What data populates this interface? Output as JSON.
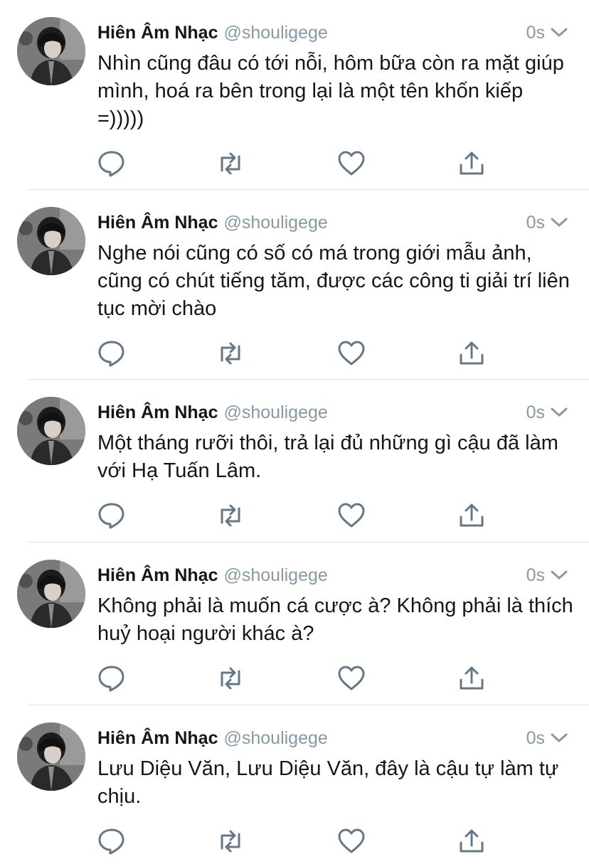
{
  "colors": {
    "text": "#14171a",
    "secondary": "#8899a6",
    "icon": "#657786",
    "divider": "#e1e4e8"
  },
  "tweets": [
    {
      "display_name": "Hiên Âm Nhạc",
      "handle": "@shouligege",
      "time": "0s",
      "text": "Nhìn cũng đâu có tới nỗi, hôm bữa còn ra mặt giúp mình, hoá ra bên trong lại là một tên khốn kiếp =)))))"
    },
    {
      "display_name": "Hiên Âm Nhạc",
      "handle": "@shouligege",
      "time": "0s",
      "text": "Nghe nói cũng có số có má trong giới mẫu ảnh, cũng có chút tiếng tăm, được các công ti giải trí liên tục mời chào"
    },
    {
      "display_name": "Hiên Âm Nhạc",
      "handle": "@shouligege",
      "time": "0s",
      "text": "Một tháng rưỡi thôi, trả lại đủ những gì cậu đã làm với Hạ Tuấn Lâm."
    },
    {
      "display_name": "Hiên Âm Nhạc",
      "handle": "@shouligege",
      "time": "0s",
      "text": "Không phải là muốn cá cược à? Không phải là thích huỷ hoại người khác à?"
    },
    {
      "display_name": "Hiên Âm Nhạc",
      "handle": "@shouligege",
      "time": "0s",
      "text": "Lưu Diệu Văn, Lưu Diệu Văn, đây là cậu tự làm tự chịu."
    }
  ]
}
